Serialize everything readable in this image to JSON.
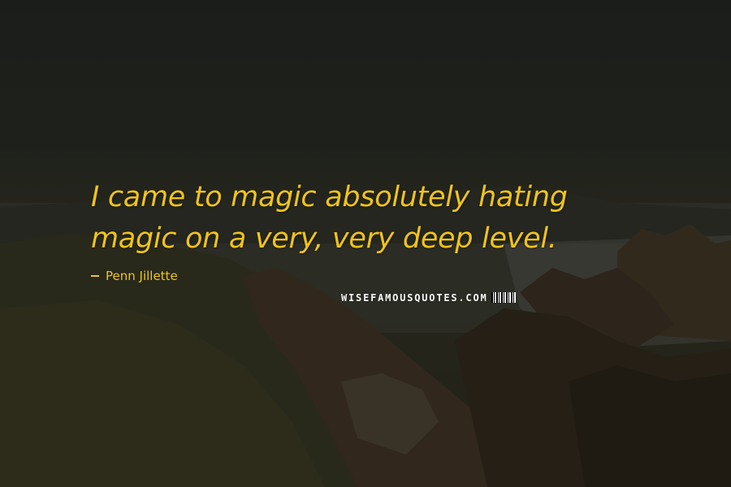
{
  "quote": {
    "line1": "I came to magic absolutely hating",
    "line2": "magic on a very, very deep level."
  },
  "author": {
    "name": "Penn Jillette"
  },
  "brand": {
    "logo_text": "WISEFAMOUSQUOTES.COM"
  },
  "colors": {
    "quote_text": "#f0c419",
    "brand_text": "#ffffff"
  }
}
